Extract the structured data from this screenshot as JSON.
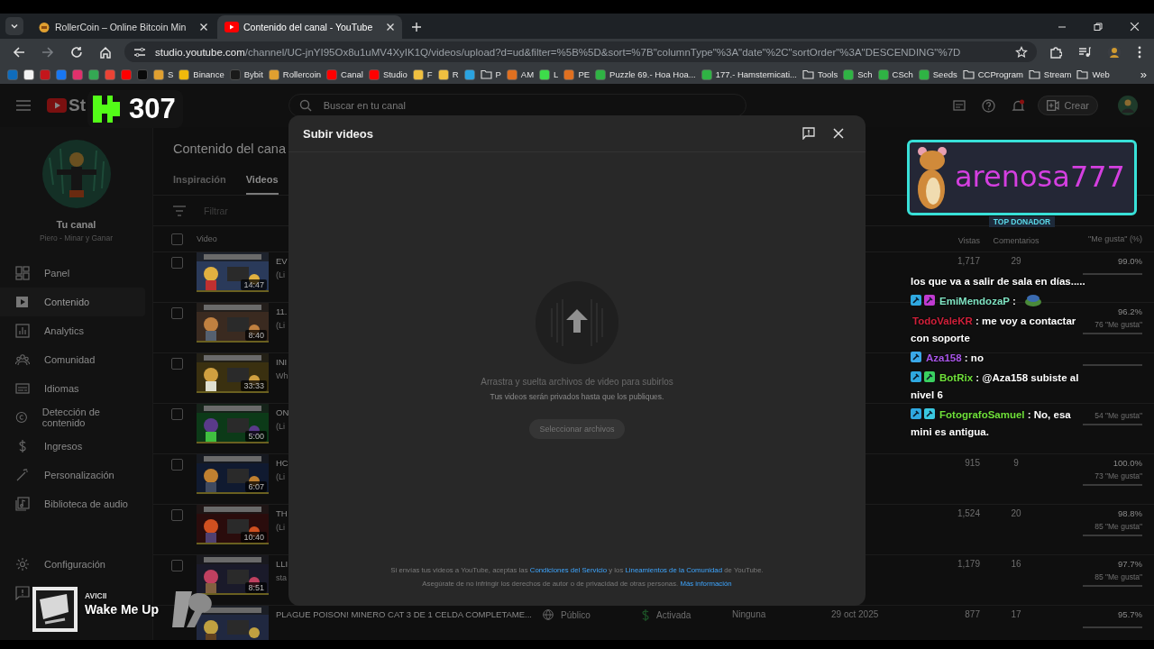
{
  "browser": {
    "tabs": [
      {
        "title": "RollerCoin – Online Bitcoin Min",
        "selected": false
      },
      {
        "title": "Contenido del canal - YouTube",
        "selected": true
      }
    ],
    "url_host": "studio.youtube.com",
    "url_rest": "/channel/UC-jnYI95Ox8u1uMV4XyIK1Q/videos/upload?d=ud&filter=%5B%5D&sort=%7B\"columnType\"%3A\"date\"%2C\"sortOrder\"%3A\"DESCENDING\"%7D",
    "bookmarks": [
      {
        "kind": "site",
        "color": "#0f6cbd"
      },
      {
        "kind": "site",
        "color": "#f2f2f2"
      },
      {
        "kind": "site",
        "color": "#c4161c"
      },
      {
        "kind": "site",
        "color": "#1877f2"
      },
      {
        "kind": "site",
        "color": "#e1306c"
      },
      {
        "kind": "site",
        "color": "#34a853"
      },
      {
        "kind": "site",
        "color": "#ea4335"
      },
      {
        "kind": "site",
        "color": "#ff0000"
      },
      {
        "kind": "site",
        "color": "#0a0a0a"
      },
      {
        "kind": "site",
        "color": "#e0a030",
        "label": "S"
      },
      {
        "kind": "site",
        "color": "#f0b90b",
        "label": "Binance"
      },
      {
        "kind": "site",
        "color": "#1a1a1a",
        "label": "Bybit"
      },
      {
        "kind": "site",
        "color": "#e0a030",
        "label": "Rollercoin"
      },
      {
        "kind": "site",
        "color": "#ff0000",
        "label": "Canal"
      },
      {
        "kind": "site",
        "color": "#ff0000",
        "label": "Studio"
      },
      {
        "kind": "site",
        "color": "#f0c040",
        "label": "F"
      },
      {
        "kind": "site",
        "color": "#f0c040",
        "label": "R"
      },
      {
        "kind": "site",
        "color": "#2aa3e0"
      },
      {
        "kind": "folder",
        "label": "P"
      },
      {
        "kind": "site",
        "color": "#e07020",
        "label": "AM"
      },
      {
        "kind": "site",
        "color": "#3ddc4a",
        "label": "L"
      },
      {
        "kind": "site",
        "color": "#e07020",
        "label": "PE"
      },
      {
        "kind": "site",
        "color": "#2fb344",
        "label": "Puzzle 69.- Hoa Hoa..."
      },
      {
        "kind": "site",
        "color": "#2fb344",
        "label": "177.- Hamsternicati..."
      },
      {
        "kind": "folder",
        "label": "Tools"
      },
      {
        "kind": "site",
        "color": "#2fb344",
        "label": "Sch"
      },
      {
        "kind": "site",
        "color": "#2fb344",
        "label": "CSch"
      },
      {
        "kind": "site",
        "color": "#2fb344",
        "label": "Seeds"
      },
      {
        "kind": "folder",
        "label": "CCProgram"
      },
      {
        "kind": "folder",
        "label": "Stream"
      },
      {
        "kind": "folder",
        "label": "Web"
      }
    ],
    "more_bookmarks": "»"
  },
  "studio": {
    "logo_text": "St",
    "search": {
      "placeholder": "Buscar en tu canal"
    },
    "create_button": "Crear",
    "channel": {
      "label": "Tu canal",
      "name": "Piero - Minar y Ganar"
    },
    "nav": [
      {
        "label": "Panel",
        "selected": false
      },
      {
        "label": "Contenido",
        "selected": true
      },
      {
        "label": "Analytics",
        "selected": false
      },
      {
        "label": "Comunidad",
        "selected": false
      },
      {
        "label": "Idiomas",
        "selected": false
      },
      {
        "label": "Detección de contenido",
        "selected": false
      },
      {
        "label": "Ingresos",
        "selected": false
      },
      {
        "label": "Personalización",
        "selected": false
      },
      {
        "label": "Biblioteca de audio",
        "selected": false
      }
    ],
    "settings": "Configuración",
    "page_title": "Contenido del cana",
    "content_tabs": [
      {
        "label": "Inspiración",
        "selected": false
      },
      {
        "label": "Videos",
        "selected": true
      }
    ],
    "filter": {
      "placeholder": "Filtrar"
    },
    "table": {
      "header_checked": false,
      "columns": {
        "video": "Video",
        "views": "Vistas",
        "comments": "Comentarios",
        "likes": "\"Me gusta\" (%)"
      },
      "rows": [
        {
          "checked": false,
          "duration": "14:47",
          "title": "EV",
          "description": "(Li",
          "views": "1,717",
          "comments": "29",
          "likes_pct": "99.0%"
        },
        {
          "checked": false,
          "duration": "8:40",
          "title": "11.",
          "description": "(Li",
          "likes_pct": "96.2%",
          "likes_count": "76 \"Me gusta\""
        },
        {
          "checked": false,
          "duration": "33:33",
          "title": "INI",
          "description": "Wh"
        },
        {
          "checked": false,
          "duration": "5:00",
          "title": "ON",
          "description": "(Li",
          "likes_count": "54 \"Me gusta\""
        },
        {
          "checked": false,
          "duration": "6:07",
          "title": "HC",
          "description": "(Li",
          "views": "915",
          "comments": "9",
          "likes_pct": "100.0%",
          "likes_count": "73 \"Me gusta\""
        },
        {
          "checked": false,
          "duration": "10:40",
          "title": "TH",
          "description": "(Li",
          "views": "1,524",
          "comments": "20",
          "likes_pct": "98.8%",
          "likes_count": "85 \"Me gusta\""
        },
        {
          "checked": false,
          "duration": "8:51",
          "title": "LLI",
          "description": "sta",
          "views": "1,179",
          "comments": "16",
          "likes_pct": "97.7%",
          "likes_count": "85 \"Me gusta\""
        },
        {
          "title": "PLAGUE POISON! MINERO CAT 3 DE 1 CELDA COMPLETAME...",
          "visibility": "Público",
          "monetization": "Activada",
          "restrictions": "Ninguna",
          "date": "29 oct 2025",
          "views": "877",
          "comments": "17",
          "likes_pct": "95.7%"
        }
      ]
    }
  },
  "upload_dialog": {
    "title": "Subir videos",
    "drop_text": "Arrastra y suelta archivos de video para subirlos",
    "privacy_note": "Tus videos serán privados hasta que los publiques.",
    "select_button": {
      "label": "Seleccionar archivos",
      "disabled": true
    },
    "terms": {
      "before": "Si envías tus videos a YouTube, aceptas las",
      "link1": "Condiciones del Servicio",
      "middle": "y los",
      "link2": "Lineamientos de la Comunidad",
      "after": "de YouTube."
    },
    "rights": {
      "text": "Asegúrate de no infringir los derechos de autor o de privacidad de otras personas.",
      "link": "Más información"
    }
  },
  "overlays": {
    "counter": "307",
    "donor": {
      "name": "arenosa777",
      "label": "TOP DONADOR"
    },
    "chat": [
      {
        "text": "los que va a salir de sala en días....."
      },
      {
        "user": "EmiMendozaP",
        "color": "#7fe3c2",
        "badges": [
          {
            "kind": "moderator"
          },
          {
            "kind": "subscriber"
          }
        ],
        "text": ":",
        "emote": true
      },
      {
        "user": "TodoValeKR",
        "color": "#d0203a",
        "text": ": me voy a contactar con soporte"
      },
      {
        "user": "Aza158",
        "color": "#a855e8",
        "badges": [
          {
            "kind": "cube"
          }
        ],
        "text": ": no"
      },
      {
        "user": "BotRix",
        "color": "#6fe03a",
        "badges": [
          {
            "kind": "moderator"
          },
          {
            "kind": "verified"
          }
        ],
        "text": ": @Aza158 subiste al nivel 6"
      },
      {
        "user": "FotografoSamuel",
        "color": "#6fe03a",
        "badges": [
          {
            "kind": "moderator"
          },
          {
            "kind": "gifter"
          }
        ],
        "text": ": No, esa mini es antigua."
      }
    ],
    "now_playing": {
      "artist": "AVICII",
      "title": "Wake Me Up"
    }
  }
}
